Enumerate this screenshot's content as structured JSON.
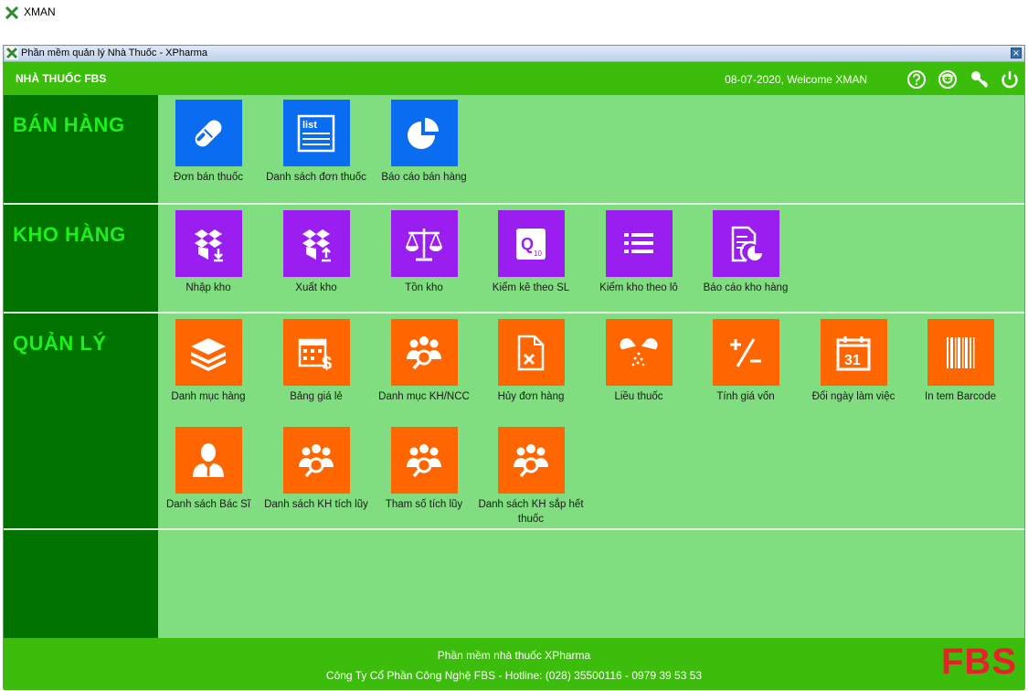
{
  "app": {
    "title": "XMAN"
  },
  "window": {
    "title": "Phần mềm quản lý Nhà Thuốc - XPharma",
    "close_label": "×"
  },
  "header": {
    "store_name": "NHÀ THUỐC FBS",
    "welcome": "08-07-2020, Welcome XMAN",
    "icons": [
      "help-icon",
      "user-icon",
      "key-icon",
      "power-icon"
    ]
  },
  "sections": {
    "sales": {
      "label": "BÁN HÀNG",
      "color": "#0a6cf0",
      "items": [
        {
          "label": "Đơn bán thuốc",
          "icon": "pill-icon"
        },
        {
          "label": "Danh sách đơn thuốc",
          "icon": "list-icon"
        },
        {
          "label": "Báo cáo bán hàng",
          "icon": "pie-chart-icon"
        }
      ]
    },
    "warehouse": {
      "label": "KHO HÀNG",
      "color": "#9b1ef0",
      "items": [
        {
          "label": "Nhập kho",
          "icon": "box-import-icon"
        },
        {
          "label": "Xuất kho",
          "icon": "box-export-icon"
        },
        {
          "label": "Tồn kho",
          "icon": "scale-icon"
        },
        {
          "label": "Kiểm kê theo SL",
          "icon": "quantity-check-icon"
        },
        {
          "label": "Kiểm kho theo lô",
          "icon": "batch-list-icon"
        },
        {
          "label": "Báo cáo kho hàng",
          "icon": "report-icon"
        }
      ]
    },
    "management": {
      "label": "QUẢN LÝ",
      "color": "#ff6600",
      "items": [
        {
          "label": "Danh mục hàng",
          "icon": "layers-icon"
        },
        {
          "label": "Bảng giá lẻ",
          "icon": "price-calendar-icon"
        },
        {
          "label": "Danh mục KH/NCC",
          "icon": "people-search-icon"
        },
        {
          "label": "Hủy đơn hàng",
          "icon": "cancel-document-icon"
        },
        {
          "label": "Liều thuốc",
          "icon": "dosage-pill-icon"
        },
        {
          "label": "Tính giá vốn",
          "icon": "plus-minus-icon"
        },
        {
          "label": "Đổi ngày làm việc",
          "icon": "calendar-icon"
        },
        {
          "label": "In tem Barcode",
          "icon": "barcode-icon"
        },
        {
          "label": "Danh sách Bác Sĩ",
          "icon": "doctor-icon"
        },
        {
          "label": "Danh sách KH tích lũy",
          "icon": "people-search-icon"
        },
        {
          "label": "Tham số tích lũy",
          "icon": "people-search-icon"
        },
        {
          "label": "Danh sách KH sắp hết thuốc",
          "icon": "people-search-icon"
        }
      ]
    }
  },
  "footer": {
    "line1": "Phần mềm nhà thuốc XPharma",
    "line2": "Công Ty Cổ Phần Công Nghệ FBS - Hotline: (028) 35500116 - 0979 39 53 53",
    "logo": "FBS"
  }
}
